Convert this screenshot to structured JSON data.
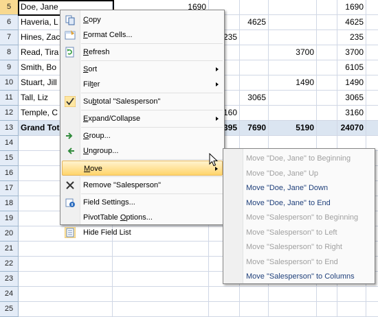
{
  "sheet": {
    "rows": [
      {
        "num": "5",
        "name": "Doe, Jane",
        "c1": "1690",
        "c2": "",
        "c3": "",
        "c4": "",
        "c5": "",
        "total": "1690",
        "selected": true
      },
      {
        "num": "6",
        "name": "Haveria, L",
        "c1": "",
        "c2": "",
        "c3": "4625",
        "c4": "",
        "c5": "",
        "total": "4625"
      },
      {
        "num": "7",
        "name": "Hines, Zac",
        "c1": "",
        "c2": "235",
        "c3": "",
        "c4": "",
        "c5": "",
        "total": "235"
      },
      {
        "num": "8",
        "name": "Read, Tira",
        "c1": "",
        "c2": "",
        "c3": "",
        "c4": "3700",
        "c5": "",
        "total": "3700"
      },
      {
        "num": "9",
        "name": "Smith, Bo",
        "c1": "",
        "c2": "",
        "c3": "",
        "c4": "",
        "c5": "",
        "total": "6105"
      },
      {
        "num": "10",
        "name": "Stuart, Jill",
        "c1": "",
        "c2": "",
        "c3": "",
        "c4": "1490",
        "c5": "",
        "total": "1490"
      },
      {
        "num": "11",
        "name": "Tall, Liz",
        "c1": "",
        "c2": "",
        "c3": "3065",
        "c4": "",
        "c5": "",
        "total": "3065"
      },
      {
        "num": "12",
        "name": "Temple, C",
        "c1": "",
        "c2": "160",
        "c3": "",
        "c4": "",
        "c5": "",
        "total": "3160"
      },
      {
        "num": "13",
        "name": "Grand Tot",
        "c1": "",
        "c2": "395",
        "c3": "7690",
        "c4": "5190",
        "c5": "",
        "total": "24070",
        "grand": true
      },
      {
        "num": "14"
      },
      {
        "num": "15"
      },
      {
        "num": "16"
      },
      {
        "num": "17"
      },
      {
        "num": "18"
      },
      {
        "num": "19"
      },
      {
        "num": "20"
      },
      {
        "num": "21"
      },
      {
        "num": "22"
      },
      {
        "num": "23"
      },
      {
        "num": "24"
      },
      {
        "num": "25"
      }
    ]
  },
  "menu": {
    "items": [
      {
        "id": "copy",
        "label": "Copy",
        "ul": "C",
        "icon": "copy-icon"
      },
      {
        "id": "format-cells",
        "label": "Format Cells...",
        "ul": "F",
        "icon": "format-cells-icon"
      },
      {
        "sep": true
      },
      {
        "id": "refresh",
        "label": "Refresh",
        "ul": "R",
        "icon": "refresh-icon"
      },
      {
        "sep": true
      },
      {
        "id": "sort",
        "label": "Sort",
        "ul": "S",
        "arrow": true
      },
      {
        "id": "filter",
        "label": "Filter",
        "ul": "t",
        "arrow": true
      },
      {
        "sep": true
      },
      {
        "id": "subtotal",
        "label": "Subtotal \"Salesperson\"",
        "ul": "b",
        "icon": "checkmark-icon"
      },
      {
        "sep": true
      },
      {
        "id": "expand-collapse",
        "label": "Expand/Collapse",
        "ul": "E",
        "arrow": true
      },
      {
        "sep": true
      },
      {
        "id": "group",
        "label": "Group...",
        "ul": "G",
        "icon": "group-icon"
      },
      {
        "id": "ungroup",
        "label": "Ungroup...",
        "ul": "U",
        "icon": "ungroup-icon"
      },
      {
        "sep": true
      },
      {
        "id": "move",
        "label": "Move",
        "ul": "M",
        "arrow": true,
        "highlighted": true
      },
      {
        "sep": true
      },
      {
        "id": "remove",
        "label": "Remove \"Salesperson\"",
        "ul": "V",
        "icon": "remove-x-icon"
      },
      {
        "sep": true
      },
      {
        "id": "field-settings",
        "label": "Field Settings...",
        "ul": "N",
        "icon": "field-settings-icon"
      },
      {
        "id": "pivottable-options",
        "label": "PivotTable Options...",
        "ul": "O",
        "icon": ""
      },
      {
        "id": "hide-field-list",
        "label": "Hide Field List",
        "ul": "D",
        "icon": "field-list-icon"
      }
    ]
  },
  "submenu": {
    "items": [
      {
        "label": "Move \"Doe, Jane\" to Beginning",
        "enabled": false
      },
      {
        "label": "Move \"Doe, Jane\" Up",
        "enabled": false
      },
      {
        "label": "Move \"Doe, Jane\" Down",
        "enabled": true
      },
      {
        "label": "Move \"Doe, Jane\" to End",
        "enabled": true
      },
      {
        "label": "Move \"Salesperson\" to Beginning",
        "enabled": false
      },
      {
        "label": "Move \"Salesperson\" to Left",
        "enabled": false
      },
      {
        "label": "Move \"Salesperson\" to Right",
        "enabled": false
      },
      {
        "label": "Move \"Salesperson\" to End",
        "enabled": false
      },
      {
        "label": "Move \"Salesperson\" to Columns",
        "enabled": true
      }
    ]
  },
  "colors": {
    "highlight": "#ffd46a",
    "disabled": "#a0a0a0",
    "enabled": "#1e3f7a"
  }
}
